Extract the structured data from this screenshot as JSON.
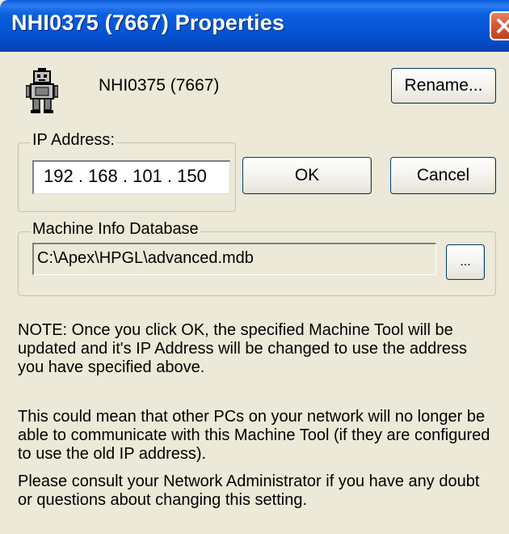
{
  "window": {
    "title": "NHI0375 (7667) Properties",
    "close_icon": "close-icon"
  },
  "device": {
    "icon": "robot-icon",
    "name": "NHI0375 (7667)"
  },
  "buttons": {
    "rename": "Rename...",
    "ok": "OK",
    "cancel": "Cancel",
    "browse": "..."
  },
  "ip_group": {
    "label": "IP Address:",
    "value": "192 . 168 . 101 . 150"
  },
  "db_group": {
    "label": "Machine Info Database",
    "value": "C:\\Apex\\HPGL\\advanced.mdb"
  },
  "notes": {
    "note1": "NOTE: Once you click OK, the specified Machine Tool will be updated and it's IP Address will be changed to use the address you have specified above.",
    "note2": "This could mean that other PCs on your network will no longer be able to communicate with this Machine Tool (if they are configured to use the old IP address).",
    "note3": "Please consult your Network Administrator if you have any doubt or questions about changing this setting."
  },
  "colors": {
    "titlebar": "#0554d4",
    "dialog_bg": "#ece9d8",
    "close_button": "#d55a37"
  }
}
